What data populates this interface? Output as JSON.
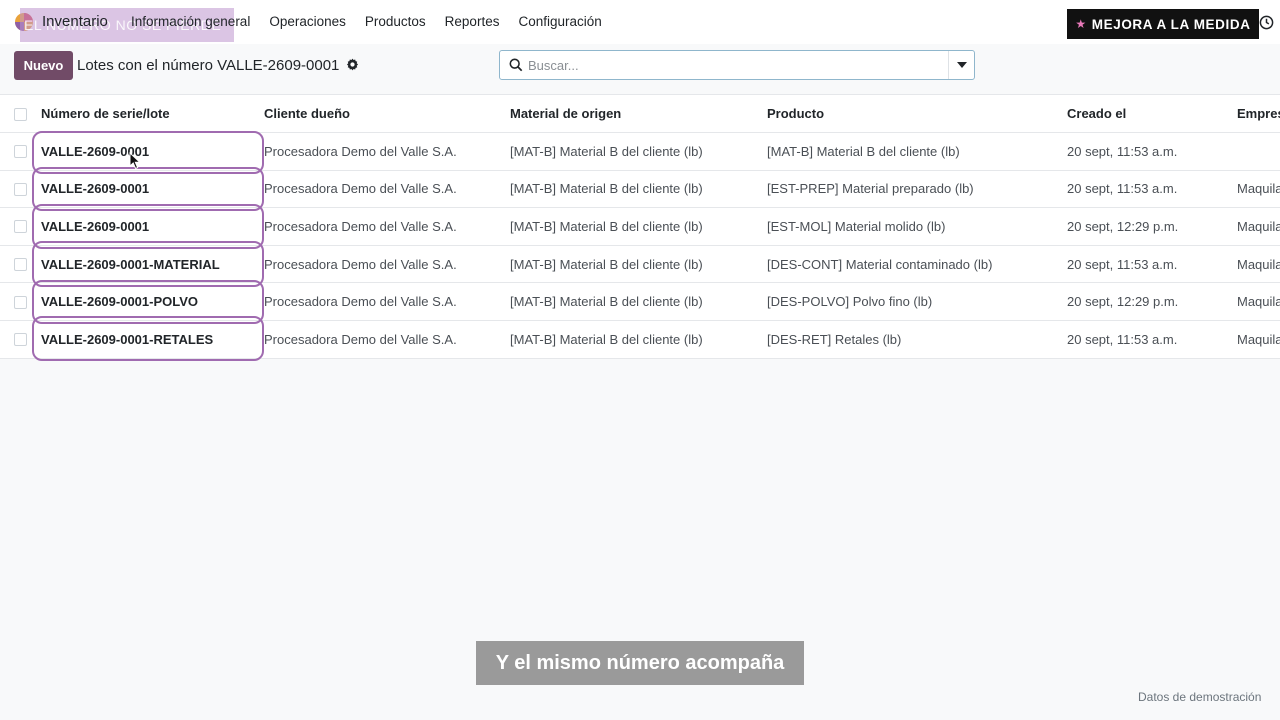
{
  "navbar": {
    "app_name": "Inventario",
    "overlay_text": "EL NÚMERO NO SE PIERDE",
    "menu": [
      "Información general",
      "Operaciones",
      "Productos",
      "Reportes",
      "Configuración"
    ],
    "promo_label": "MEJORA A LA MEDIDA",
    "promo_star": "★"
  },
  "control_panel": {
    "new_label": "Nuevo",
    "title": "Lotes con el número VALLE-2609-0001",
    "search_placeholder": "Buscar..."
  },
  "table": {
    "headers": {
      "lot": "Número de serie/lote",
      "owner": "Cliente dueño",
      "material": "Material de origen",
      "product": "Producto",
      "created": "Creado el",
      "company": "Empresa"
    },
    "rows": [
      {
        "lot": "VALLE-2609-0001",
        "owner": "Procesadora Demo del Valle S.A.",
        "material": "[MAT-B] Material B del cliente (lb)",
        "product": "[MAT-B] Material B del cliente (lb)",
        "created": "20 sept, 11:53 a.m.",
        "company": ""
      },
      {
        "lot": "VALLE-2609-0001",
        "owner": "Procesadora Demo del Valle S.A.",
        "material": "[MAT-B] Material B del cliente (lb)",
        "product": "[EST-PREP] Material preparado (lb)",
        "created": "20 sept, 11:53 a.m.",
        "company": "Maquila"
      },
      {
        "lot": "VALLE-2609-0001",
        "owner": "Procesadora Demo del Valle S.A.",
        "material": "[MAT-B] Material B del cliente (lb)",
        "product": "[EST-MOL] Material molido (lb)",
        "created": "20 sept, 12:29 p.m.",
        "company": "Maquila"
      },
      {
        "lot": "VALLE-2609-0001-MATERIAL",
        "owner": "Procesadora Demo del Valle S.A.",
        "material": "[MAT-B] Material B del cliente (lb)",
        "product": "[DES-CONT] Material contaminado (lb)",
        "created": "20 sept, 11:53 a.m.",
        "company": "Maquila"
      },
      {
        "lot": "VALLE-2609-0001-POLVO",
        "owner": "Procesadora Demo del Valle S.A.",
        "material": "[MAT-B] Material B del cliente (lb)",
        "product": "[DES-POLVO] Polvo fino (lb)",
        "created": "20 sept, 12:29 p.m.",
        "company": "Maquila"
      },
      {
        "lot": "VALLE-2609-0001-RETALES",
        "owner": "Procesadora Demo del Valle S.A.",
        "material": "[MAT-B] Material B del cliente (lb)",
        "product": "[DES-RET] Retales (lb)",
        "created": "20 sept, 11:53 a.m.",
        "company": "Maquila"
      }
    ]
  },
  "caption": "Y el mismo número acompaña",
  "demo_label": "Datos de demostración",
  "colors": {
    "brand": "#714b67",
    "highlight": "#a06bb0",
    "promo_bg": "#111111"
  }
}
